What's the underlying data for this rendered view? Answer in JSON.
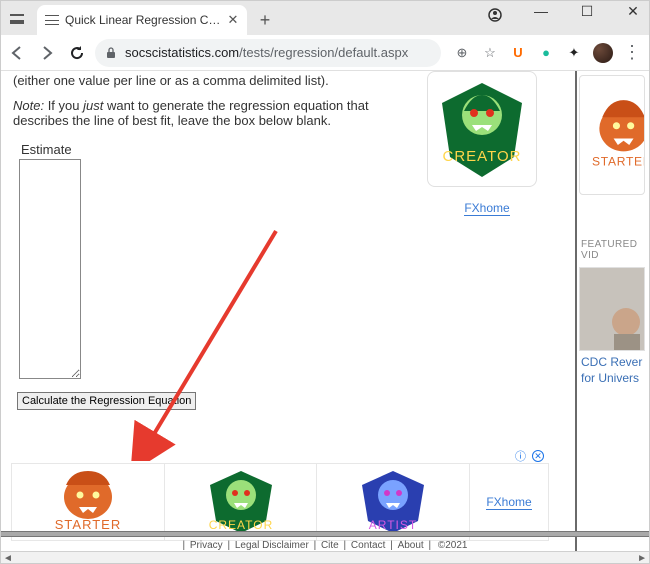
{
  "browser": {
    "tab_title": "Quick Linear Regression Calculat",
    "new_tab_label": "+",
    "win_min": "—",
    "win_max": "☐",
    "win_close": "✕",
    "url_host": "socscistatistics.com",
    "url_path": "/tests/regression/default.aspx",
    "zoom_icon": "⊕",
    "star_icon": "☆",
    "ext_u": "U",
    "ext_dot": "●",
    "ext_puzzle": "✦",
    "kebab": "⋮"
  },
  "page": {
    "intro_line1": "(either one value per line or as a comma delimited list).",
    "note_prefix": "Note:",
    "note_mid1": " If you ",
    "note_italic": "just",
    "note_mid2": " want to generate the regression equation that describes the line of best fit, leave the box below blank.",
    "estimate_label": "Estimate",
    "calc_button": "Calculate the Regression Equation",
    "fxhome": "FXhome"
  },
  "ads": {
    "creator_label": "CREATOR",
    "starter_label": "STARTER",
    "artist_label": "ARTIST",
    "info_icon": "ⓘ",
    "close_icon": "✕"
  },
  "sidebar": {
    "featured_heading": "FEATURED VID",
    "vid_caption": "CDC Rever",
    "vid_title_l1": "CDC Rever",
    "vid_title_l2": "for Univers"
  },
  "footer": {
    "privacy": "Privacy",
    "legal": "Legal Disclaimer",
    "cite": "Cite",
    "contact": "Contact",
    "about": "About",
    "copyright": "©2021",
    "sep": " | "
  }
}
